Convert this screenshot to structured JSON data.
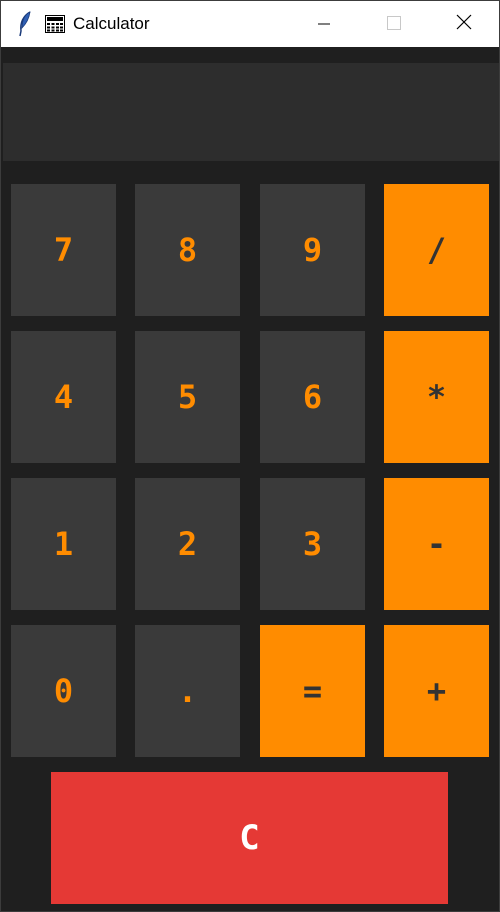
{
  "window": {
    "title": "Calculator",
    "icons": [
      "feather-icon",
      "calculator-app-icon"
    ],
    "controls": [
      "minimize",
      "maximize",
      "close"
    ]
  },
  "display": {
    "value": ""
  },
  "keys": {
    "row1": [
      "7",
      "8",
      "9",
      "/"
    ],
    "row2": [
      "4",
      "5",
      "6",
      "*"
    ],
    "row3": [
      "1",
      "2",
      "3",
      "-"
    ],
    "row4": [
      "0",
      ".",
      "=",
      "+"
    ],
    "clear": "C"
  },
  "colors": {
    "background": "#1f1f1f",
    "display_bg": "#2d2d2d",
    "number_key_bg": "#3a3a3a",
    "number_key_text": "#ff8c00",
    "operator_key_bg": "#ff8c00",
    "operator_key_text": "#333333",
    "clear_key_bg": "#e53935",
    "clear_key_text": "#ffffff"
  }
}
